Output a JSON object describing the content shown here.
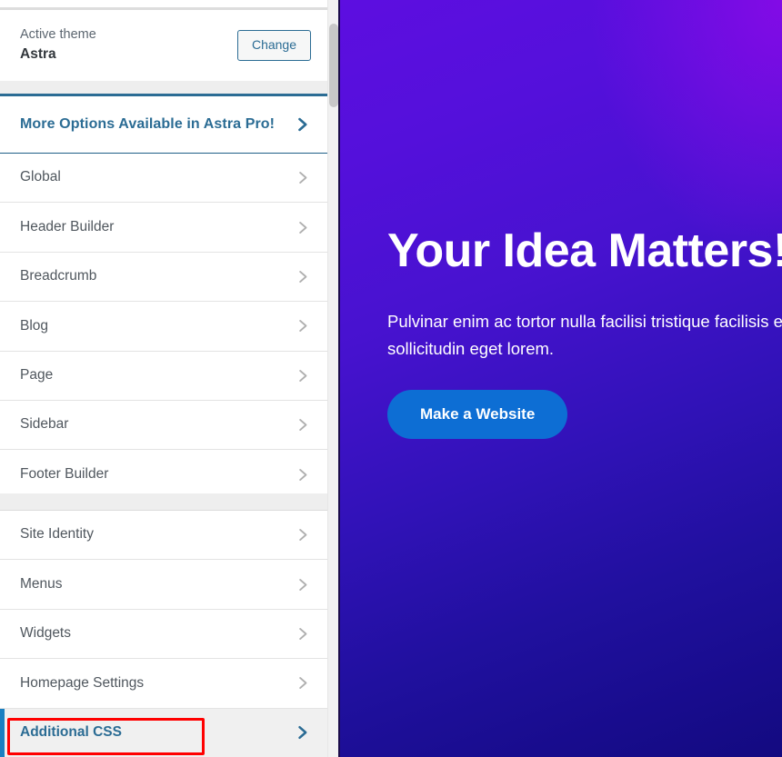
{
  "sidebar": {
    "theme": {
      "label": "Active theme",
      "name": "Astra",
      "change_label": "Change"
    },
    "pro_banner": {
      "label": "More Options Available in Astra Pro!",
      "icon": "chevron-right-icon"
    },
    "group_a": [
      {
        "label": "Global",
        "icon": "chevron-right-icon"
      },
      {
        "label": "Header Builder",
        "icon": "chevron-right-icon"
      },
      {
        "label": "Breadcrumb",
        "icon": "chevron-right-icon"
      },
      {
        "label": "Blog",
        "icon": "chevron-right-icon"
      },
      {
        "label": "Page",
        "icon": "chevron-right-icon"
      },
      {
        "label": "Sidebar",
        "icon": "chevron-right-icon"
      },
      {
        "label": "Footer Builder",
        "icon": "chevron-right-icon"
      }
    ],
    "group_b": [
      {
        "label": "Site Identity",
        "icon": "chevron-right-icon",
        "active": false
      },
      {
        "label": "Menus",
        "icon": "chevron-right-icon",
        "active": false
      },
      {
        "label": "Widgets",
        "icon": "chevron-right-icon",
        "active": false
      },
      {
        "label": "Homepage Settings",
        "icon": "chevron-right-icon",
        "active": false
      },
      {
        "label": "Additional CSS",
        "icon": "chevron-right-icon",
        "active": true
      }
    ]
  },
  "preview": {
    "hero_title": "Your Idea Matters!",
    "hero_subtitle": "Pulvinar enim ac tortor nulla facilisi tristique facilisis elementum sollicitudin eget lorem.",
    "cta_label": "Make a Website"
  },
  "colors": {
    "accent_blue": "#2b6c94",
    "active_bar": "#1a7fc1",
    "annotation_red": "#ff0000",
    "cta_blue": "#0d6ed4",
    "gradient_start": "#5d0ee0",
    "gradient_end": "#130a80"
  }
}
